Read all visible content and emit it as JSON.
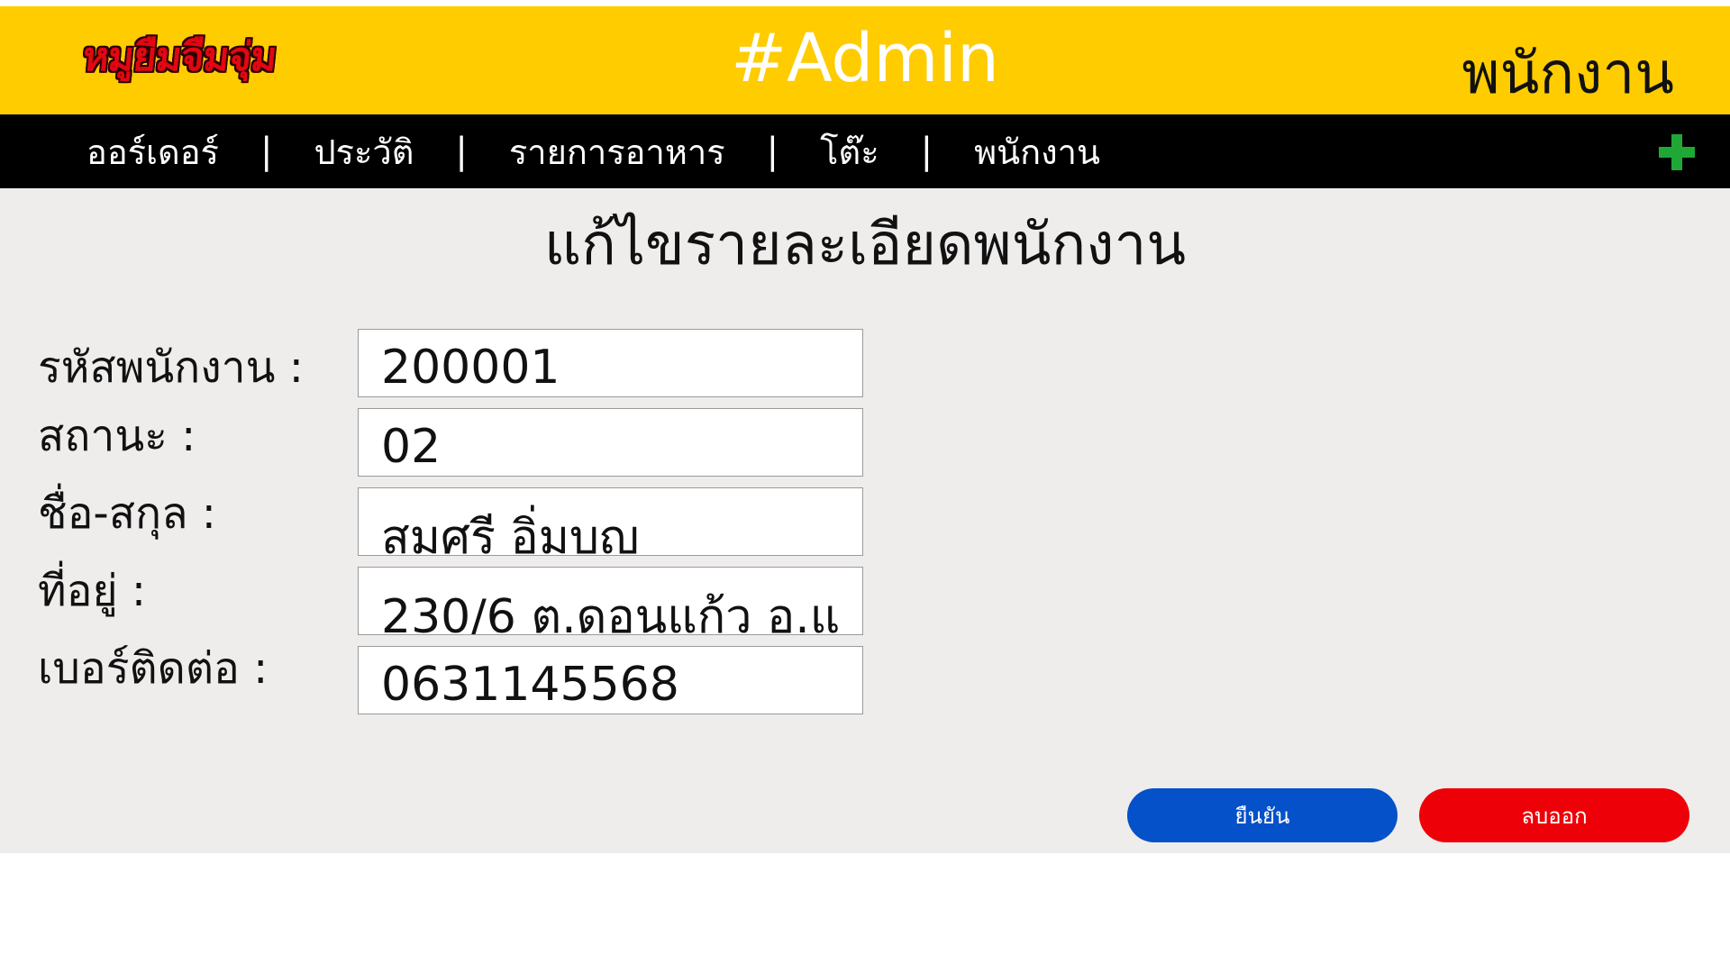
{
  "header": {
    "logo_text": "หมูยืมจืมจุ่ม",
    "title": "#Admin",
    "section": "พนักงาน"
  },
  "colors": {
    "header_bg": "#ffcc00",
    "nav_bg": "#000000",
    "content_bg": "#efecec",
    "plus_icon": "#1fa835",
    "confirm_button": "#0551c9",
    "delete_button": "#ee0008"
  },
  "nav": {
    "items": [
      {
        "label": "ออร์เดอร์"
      },
      {
        "label": "ประวัติ"
      },
      {
        "label": "รายการอาหาร"
      },
      {
        "label": "โต๊ะ"
      },
      {
        "label": "พนักงาน"
      }
    ],
    "separator": "|",
    "add_icon": "plus-icon"
  },
  "page": {
    "title": "แก้ไขรายละเอียดพนักงาน"
  },
  "form": {
    "employee_id": {
      "label": "รหัสพนักงาน :",
      "value": "200001"
    },
    "status": {
      "label": "สถานะ :",
      "value": "02"
    },
    "full_name": {
      "label": "ชื่อ-สกุล :",
      "value": "สมศรี อิ่มบุญ"
    },
    "address": {
      "label": "ที่อยู่ :",
      "value": "230/6 ต.ดอนแก้ว อ.แ"
    },
    "phone": {
      "label": "เบอร์ติดต่อ :",
      "value": "0631145568"
    }
  },
  "actions": {
    "confirm_label": "ยืนยัน",
    "delete_label": "ลบออก"
  }
}
